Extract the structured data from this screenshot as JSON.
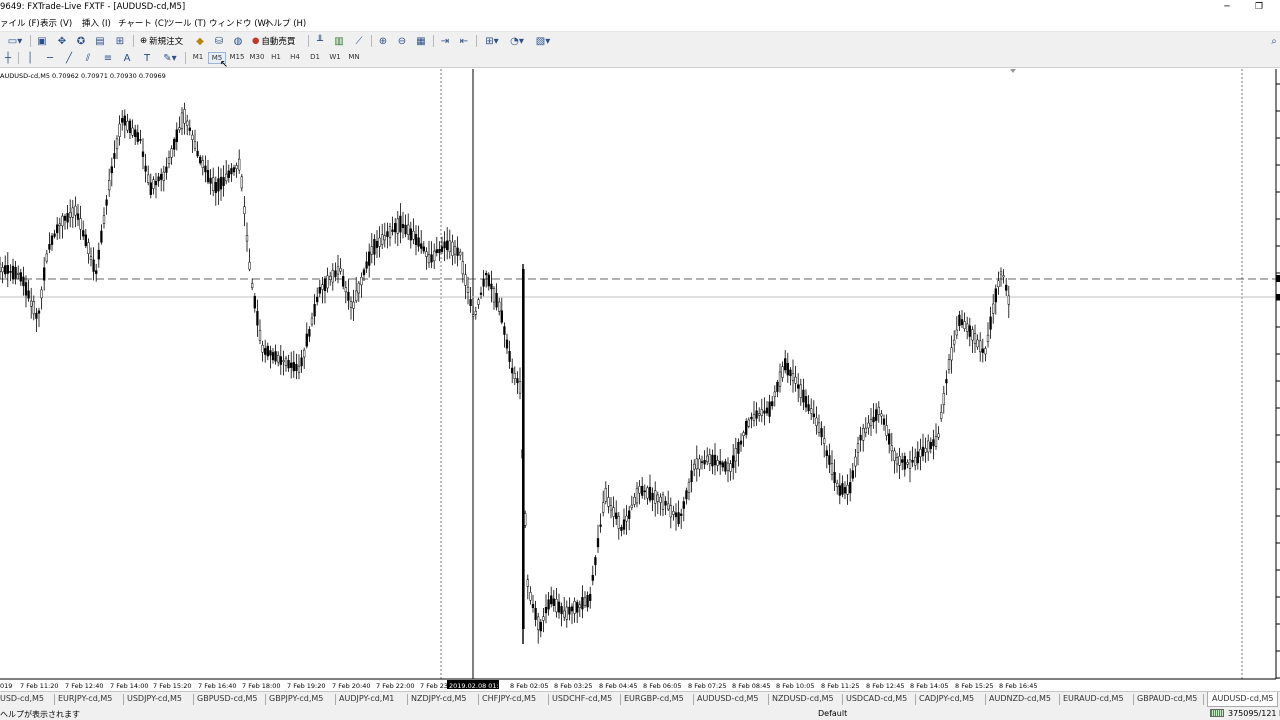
{
  "window": {
    "title": "9649: FXTrade-Live FXTF - [AUDUSD-cd,M5]",
    "minimize": "─",
    "restore": "❐"
  },
  "menu": [
    "ァイル (F)",
    "表示 (V)",
    "挿入 (I)",
    "チャート (C)",
    "ツール (T)",
    "ウィンドウ (W)",
    "ヘルプ (H)"
  ],
  "toolbar": {
    "new_order": "新規注文",
    "auto_trade": "自動売買"
  },
  "timeframes": [
    "M1",
    "M5",
    "M15",
    "M30",
    "H1",
    "H4",
    "D1",
    "W1",
    "MN"
  ],
  "active_timeframe": "M5",
  "chart": {
    "info_line": "AUDUSD-cd,M5  0.70962 0.70971 0.70930 0.70969",
    "crosshair_time": "2019.02.08 01:00",
    "first_label": "019",
    "time_labels": [
      "7 Feb 11:20",
      "7 Feb 12:40",
      "7 Feb 14:00",
      "7 Feb 15:20",
      "7 Feb 16:40",
      "7 Feb 18:00",
      "7 Feb 19:20",
      "7 Feb 20:40",
      "7 Feb 22:00",
      "7 Feb 23:",
      "8 Feb 02:05",
      "8 Feb 03:25",
      "8 Feb 04:45",
      "8 Feb 06:05",
      "8 Feb 07:25",
      "8 Feb 08:45",
      "8 Feb 10:05",
      "8 Feb 11:25",
      "8 Feb 12:45",
      "8 Feb 14:05",
      "8 Feb 15:25",
      "8 Feb 16:45"
    ],
    "colors": {
      "candle": "#000000",
      "grid": "#000000",
      "bid_line": "#c0c0c0"
    }
  },
  "symbol_tabs": [
    "USD-cd,M5",
    "EURJPY-cd,M5",
    "USDJPY-cd,M5",
    "GBPUSD-cd,M5",
    "GBPJPY-cd,M5",
    "AUDJPY-cd,M1",
    "NZDJPY-cd,M5",
    "CHFJPY-cd,M5",
    "USDCHF-cd,M5",
    "EURGBP-cd,M5",
    "AUDUSD-cd,M5",
    "NZDUSD-cd,M5",
    "USDCAD-cd,M5",
    "CADJPY-cd,M5",
    "AUDNZD-cd,M5",
    "EURAUD-cd,M5",
    "GBPAUD-cd,M5",
    "AUDUSD-cd,M5"
  ],
  "active_tab_index": 17,
  "status": {
    "help": "ヘルプが表示されます",
    "profile": "Default",
    "traffic": "375095/121 kb"
  }
}
